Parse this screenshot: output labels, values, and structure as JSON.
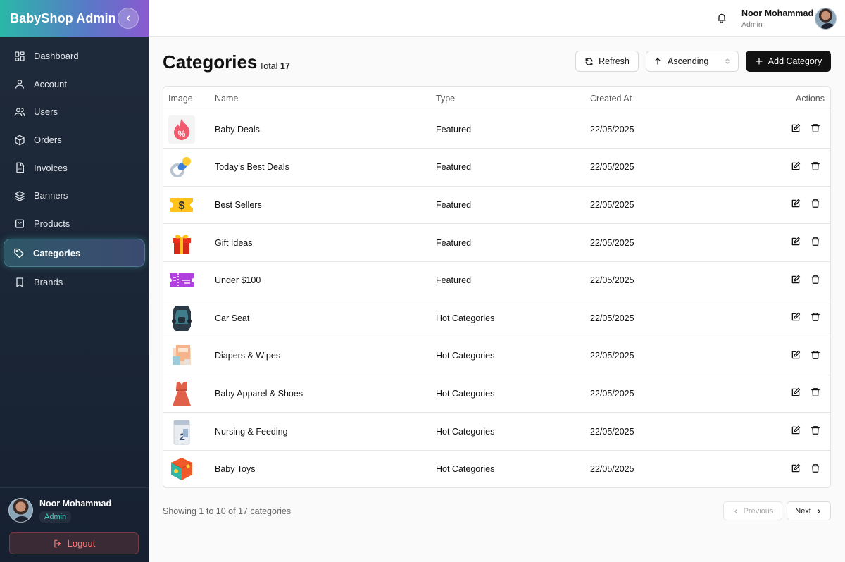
{
  "brand": {
    "title": "BabyShop Admin"
  },
  "sidebar": {
    "items": [
      {
        "label": "Dashboard",
        "icon": "dashboard-icon"
      },
      {
        "label": "Account",
        "icon": "user-icon"
      },
      {
        "label": "Users",
        "icon": "users-icon"
      },
      {
        "label": "Orders",
        "icon": "box-icon"
      },
      {
        "label": "Invoices",
        "icon": "file-icon"
      },
      {
        "label": "Banners",
        "icon": "layers-icon"
      },
      {
        "label": "Products",
        "icon": "bag-icon"
      },
      {
        "label": "Categories",
        "icon": "tag-icon",
        "active": true
      },
      {
        "label": "Brands",
        "icon": "bookmark-icon"
      }
    ],
    "user": {
      "name": "Noor Mohammad",
      "role": "Admin"
    },
    "logout_label": "Logout"
  },
  "header": {
    "user": {
      "name": "Noor Mohammad",
      "role": "Admin"
    }
  },
  "page": {
    "title": "Categories",
    "total_label": "Total",
    "total_value": "17",
    "refresh_label": "Refresh",
    "sort_value": "Ascending",
    "add_label": "Add Category"
  },
  "table": {
    "columns": {
      "image": "Image",
      "name": "Name",
      "type": "Type",
      "created": "Created At",
      "actions": "Actions"
    },
    "rows": [
      {
        "name": "Baby Deals",
        "type": "Featured",
        "created": "22/05/2025",
        "image": "discount-flame-icon"
      },
      {
        "name": "Today's Best Deals",
        "type": "Featured",
        "created": "22/05/2025",
        "image": "pacifier-icon"
      },
      {
        "name": "Best Sellers",
        "type": "Featured",
        "created": "22/05/2025",
        "image": "dollar-ticket-icon"
      },
      {
        "name": "Gift Ideas",
        "type": "Featured",
        "created": "22/05/2025",
        "image": "gift-box-icon"
      },
      {
        "name": "Under $100",
        "type": "Featured",
        "created": "22/05/2025",
        "image": "voucher-icon"
      },
      {
        "name": "Car Seat",
        "type": "Hot Categories",
        "created": "22/05/2025",
        "image": "car-seat-image"
      },
      {
        "name": "Diapers & Wipes",
        "type": "Hot Categories",
        "created": "22/05/2025",
        "image": "diapers-image"
      },
      {
        "name": "Baby Apparel & Shoes",
        "type": "Hot Categories",
        "created": "22/05/2025",
        "image": "baby-dress-image"
      },
      {
        "name": "Nursing & Feeding",
        "type": "Hot Categories",
        "created": "22/05/2025",
        "image": "formula-can-image"
      },
      {
        "name": "Baby Toys",
        "type": "Hot Categories",
        "created": "22/05/2025",
        "image": "toy-cube-image"
      }
    ]
  },
  "pagination": {
    "showing": "Showing 1 to 10 of 17 categories",
    "prev_label": "Previous",
    "next_label": "Next"
  },
  "colors": {
    "accent": "#2bb7a8",
    "brand_gradient_end": "#8a5ad0",
    "sidebar_bg": "#1f2a3a",
    "danger": "#ff7b7b"
  }
}
